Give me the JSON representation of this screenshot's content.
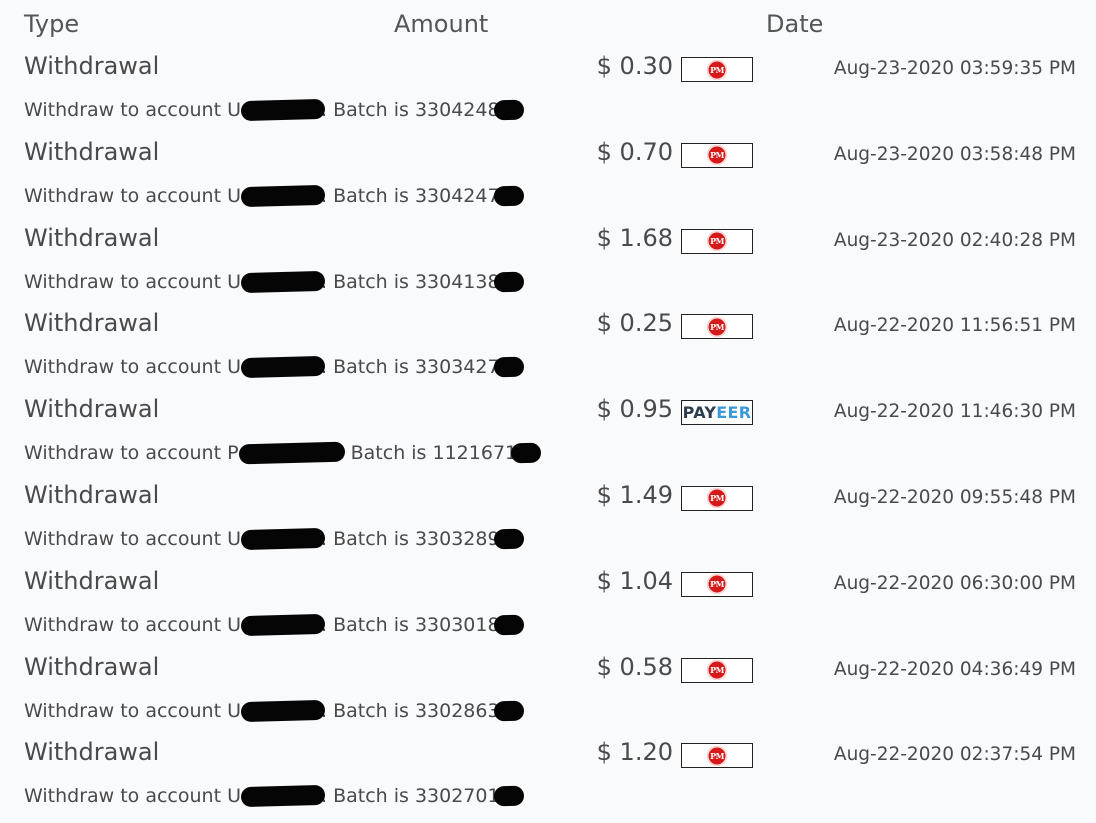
{
  "header": {
    "type_label": "Type",
    "amount_label": "Amount",
    "date_label": "Date"
  },
  "rows": [
    {
      "type": "Withdrawal",
      "amount": "$ 0.30",
      "method": "PM",
      "date": "Aug-23-2020 03:59:35 PM",
      "desc_prefix": "Withdraw to account U",
      "desc_mid": ". Batch is 3304248"
    },
    {
      "type": "Withdrawal",
      "amount": "$ 0.70",
      "method": "PM",
      "date": "Aug-23-2020 03:58:48 PM",
      "desc_prefix": "Withdraw to account U",
      "desc_mid": ". Batch is 3304247"
    },
    {
      "type": "Withdrawal",
      "amount": "$ 1.68",
      "method": "PM",
      "date": "Aug-23-2020 02:40:28 PM",
      "desc_prefix": "Withdraw to account U",
      "desc_mid": ". Batch is 3304138"
    },
    {
      "type": "Withdrawal",
      "amount": "$ 0.25",
      "method": "PM",
      "date": "Aug-22-2020 11:56:51 PM",
      "desc_prefix": "Withdraw to account U",
      "desc_mid": ". Batch is 3303427"
    },
    {
      "type": "Withdrawal",
      "amount": "$ 0.95",
      "method": "PAYEER",
      "date": "Aug-22-2020 11:46:30 PM",
      "desc_prefix": "Withdraw to account P",
      "desc_mid": ". Batch is 1121671"
    },
    {
      "type": "Withdrawal",
      "amount": "$ 1.49",
      "method": "PM",
      "date": "Aug-22-2020 09:55:48 PM",
      "desc_prefix": "Withdraw to account U",
      "desc_mid": ". Batch is 3303289"
    },
    {
      "type": "Withdrawal",
      "amount": "$ 1.04",
      "method": "PM",
      "date": "Aug-22-2020 06:30:00 PM",
      "desc_prefix": "Withdraw to account U",
      "desc_mid": ". Batch is 3303018"
    },
    {
      "type": "Withdrawal",
      "amount": "$ 0.58",
      "method": "PM",
      "date": "Aug-22-2020 04:36:49 PM",
      "desc_prefix": "Withdraw to account U",
      "desc_mid": ". Batch is 3302863"
    },
    {
      "type": "Withdrawal",
      "amount": "$ 1.20",
      "method": "PM",
      "date": "Aug-22-2020 02:37:54 PM",
      "desc_prefix": "Withdraw to account U",
      "desc_mid": ". Batch is 3302701"
    }
  ],
  "badges": {
    "pm_text": "PM",
    "payeer_pay": "PAY",
    "payeer_eer": "EER"
  },
  "colors": {
    "pm_red": "#d61a1a",
    "payeer_dark": "#2c3e50",
    "payeer_blue": "#3a9ad9",
    "text": "#4a4a4a",
    "background": "#f9fafc"
  }
}
